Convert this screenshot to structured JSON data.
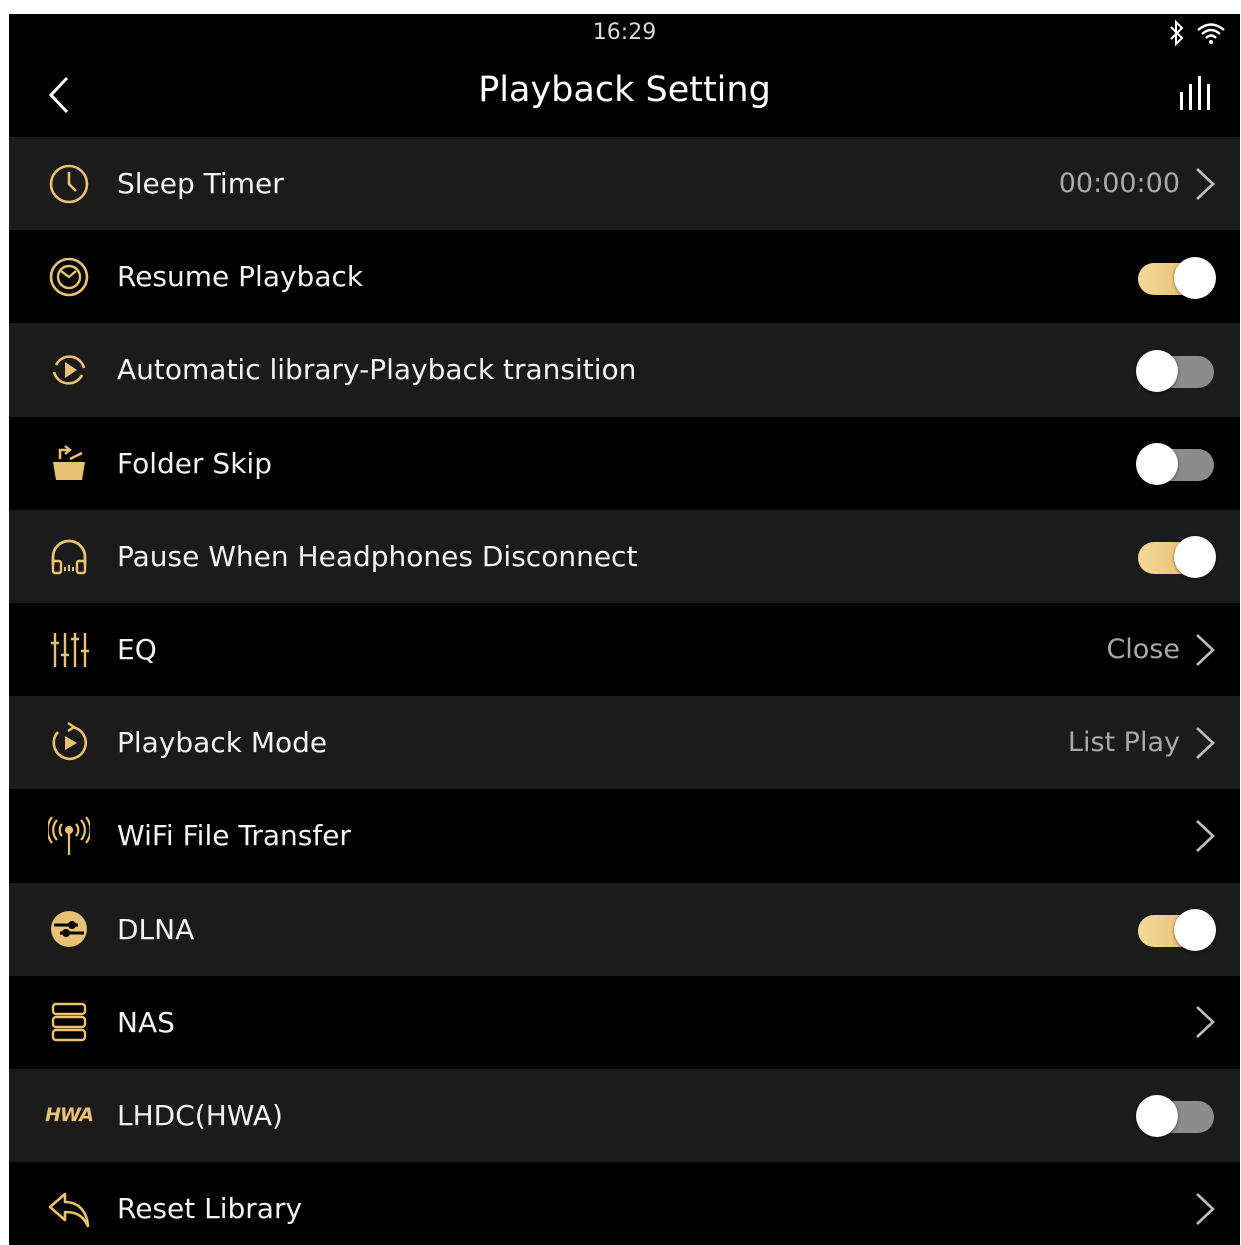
{
  "status_bar": {
    "time": "16:29",
    "icons": [
      "bluetooth-icon",
      "wifi-icon"
    ]
  },
  "header": {
    "title": "Playback Setting",
    "back_icon": "chevron-left-icon",
    "right_icon": "equalizer-bars-icon"
  },
  "accent_color": "#e8c274",
  "settings": [
    {
      "label": "Sleep Timer",
      "icon": "clock-icon",
      "value": "00:00:00",
      "control": "link"
    },
    {
      "label": "Resume Playback",
      "icon": "resume-icon",
      "control": "toggle",
      "on": true
    },
    {
      "label": "Automatic library-Playback transition",
      "icon": "auto-play-icon",
      "control": "toggle",
      "on": false
    },
    {
      "label": "Folder Skip",
      "icon": "folder-skip-icon",
      "control": "toggle",
      "on": false
    },
    {
      "label": "Pause When Headphones Disconnect",
      "icon": "headphones-icon",
      "control": "toggle",
      "on": true
    },
    {
      "label": "EQ",
      "icon": "eq-sliders-icon",
      "value": "Close",
      "control": "link"
    },
    {
      "label": "Playback Mode",
      "icon": "playback-mode-icon",
      "value": "List Play",
      "control": "link"
    },
    {
      "label": "WiFi File Transfer",
      "icon": "antenna-icon",
      "control": "link"
    },
    {
      "label": "DLNA",
      "icon": "dlna-icon",
      "control": "toggle",
      "on": true
    },
    {
      "label": "NAS",
      "icon": "nas-icon",
      "control": "link"
    },
    {
      "label": "LHDC(HWA)",
      "icon": "hwa-logo-icon",
      "icon_text": "HWA",
      "control": "toggle",
      "on": false
    },
    {
      "label": "Reset Library",
      "icon": "reset-icon",
      "control": "link"
    }
  ]
}
